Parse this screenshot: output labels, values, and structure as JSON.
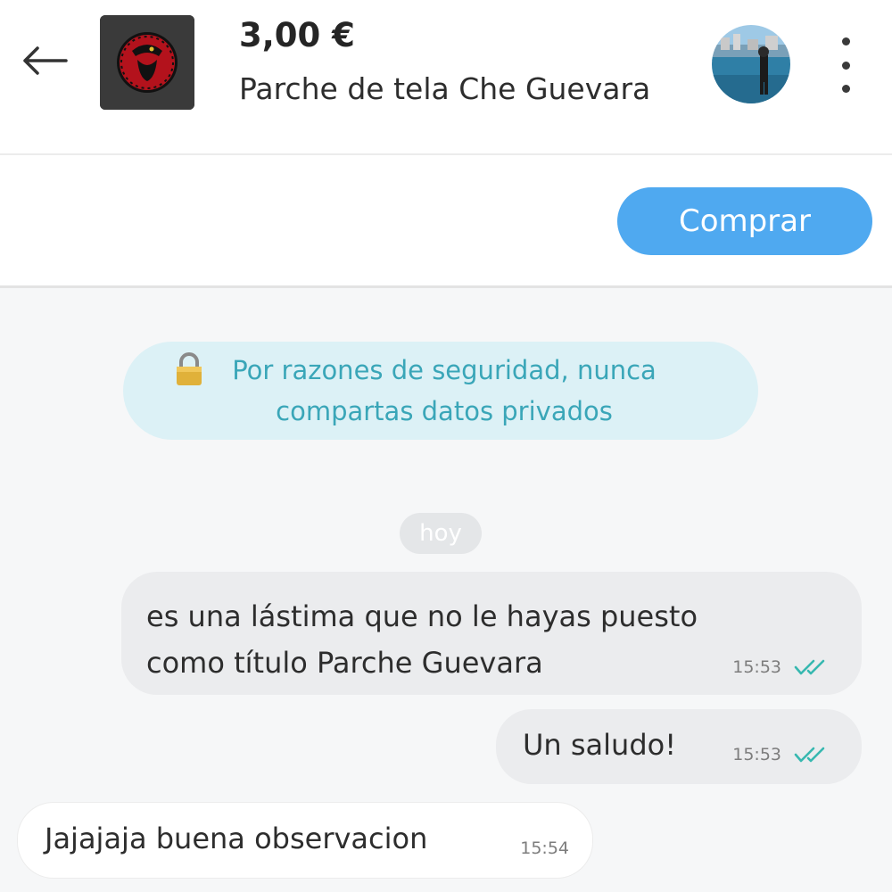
{
  "header": {
    "price": "3,00 €",
    "item_title": "Parche de tela Che Guevara"
  },
  "actions": {
    "buy_label": "Comprar"
  },
  "notice": {
    "text": "Por razones de seguridad, nunca compartas datos privados"
  },
  "date_separator": "hoy",
  "messages": [
    {
      "direction": "out",
      "text": "es una lástima que no le hayas puesto como título Parche Guevara",
      "time": "15:53",
      "status": "read"
    },
    {
      "direction": "out",
      "text": "Un saludo!",
      "time": "15:53",
      "status": "read"
    },
    {
      "direction": "in",
      "text": "Jajajaja buena observacion",
      "time": "15:54"
    }
  ],
  "icons": {
    "back": "arrow-left-icon",
    "more": "more-vertical-icon",
    "lock": "padlock-icon",
    "read_receipt": "double-check-icon"
  },
  "colors": {
    "accent": "#4fa9f0",
    "notice_bg": "#dcf1f6",
    "notice_text": "#3aa6b8",
    "read_check": "#37b8b0"
  }
}
